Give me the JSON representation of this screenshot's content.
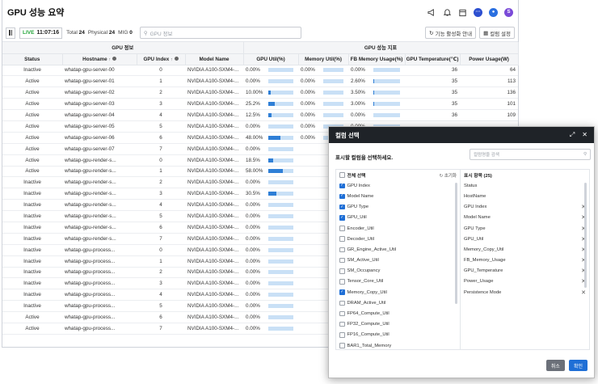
{
  "header": {
    "title": "GPU 성능 요약"
  },
  "toolbar": {
    "live": "LIVE",
    "time": "11:07:16",
    "total_label": "Total",
    "total": "24",
    "physical_label": "Physical",
    "physical": "24",
    "mig_label": "MIG",
    "mig": "0",
    "search_placeholder": "GPU 정보",
    "guide_label": "기능 활성화 안내",
    "column_label": "컬럼 설정"
  },
  "table": {
    "group_gpu_info": "GPU 정보",
    "group_gpu_perf": "GPU 성능 지표",
    "columns": [
      "Status",
      "Hostname",
      "GPU Index",
      "Model Name",
      "GPU Util(%)",
      "Memory Util(%)",
      "FB Memory Usage(%)",
      "GPU Temperature(℃)",
      "Power Usage(W)"
    ],
    "rows": [
      {
        "status": "Inactive",
        "host": "whatap-gpu-server-00",
        "idx": "0",
        "model": "NVIDIA A100-SXM4-...",
        "gpu": "0.00%",
        "gpu_v": 0,
        "mem": "0.00%",
        "mem_v": 0,
        "fb": "0.00%",
        "fb_v": 0,
        "temp": "36",
        "power": "64"
      },
      {
        "status": "Active",
        "host": "whatap-gpu-server-01",
        "idx": "1",
        "model": "NVIDIA A100-SXM4-...",
        "gpu": "0.00%",
        "gpu_v": 0,
        "mem": "0.00%",
        "mem_v": 0,
        "fb": "2.60%",
        "fb_v": 2.6,
        "temp": "35",
        "power": "113"
      },
      {
        "status": "Active",
        "host": "whatap-gpu-server-02",
        "idx": "2",
        "model": "NVIDIA A100-SXM4-...",
        "gpu": "10.00%",
        "gpu_v": 10,
        "mem": "0.00%",
        "mem_v": 0,
        "fb": "3.50%",
        "fb_v": 3.5,
        "temp": "35",
        "power": "136"
      },
      {
        "status": "Active",
        "host": "whatap-gpu-server-03",
        "idx": "3",
        "model": "NVIDIA A100-SXM4-...",
        "gpu": "25.2%",
        "gpu_v": 25.2,
        "mem": "0.00%",
        "mem_v": 0,
        "fb": "3.00%",
        "fb_v": 3,
        "temp": "35",
        "power": "101"
      },
      {
        "status": "Active",
        "host": "whatap-gpu-server-04",
        "idx": "4",
        "model": "NVIDIA A100-SXM4-...",
        "gpu": "12.5%",
        "gpu_v": 12.5,
        "mem": "0.00%",
        "mem_v": 0,
        "fb": "0.00%",
        "fb_v": 0,
        "temp": "36",
        "power": "109"
      },
      {
        "status": "Active",
        "host": "whatap-gpu-server-05",
        "idx": "5",
        "model": "NVIDIA A100-SXM4-...",
        "gpu": "0.00%",
        "gpu_v": 0,
        "mem": "0.00%",
        "mem_v": 0,
        "fb": "0.00%",
        "fb_v": 0,
        "temp": "",
        "power": ""
      },
      {
        "status": "Active",
        "host": "whatap-gpu-server-06",
        "idx": "6",
        "model": "NVIDIA A100-SXM4-...",
        "gpu": "48.00%",
        "gpu_v": 48,
        "mem": "0.00%",
        "mem_v": 0,
        "fb": "",
        "fb_v": 0,
        "temp": "",
        "power": ""
      },
      {
        "status": "Active",
        "host": "whatap-gpu-server-07",
        "idx": "7",
        "model": "NVIDIA A100-SXM4-...",
        "gpu": "0.00%",
        "gpu_v": 0,
        "mem": "",
        "mem_v": 0,
        "fb": "",
        "fb_v": 0,
        "temp": "",
        "power": ""
      },
      {
        "status": "Active",
        "host": "whatap-gpu-render-s...",
        "idx": "0",
        "model": "NVIDIA A100-SXM4-...",
        "gpu": "18.5%",
        "gpu_v": 18.5,
        "mem": "",
        "mem_v": 0,
        "fb": "",
        "fb_v": 0,
        "temp": "",
        "power": ""
      },
      {
        "status": "Active",
        "host": "whatap-gpu-render-s...",
        "idx": "1",
        "model": "NVIDIA A100-SXM4-...",
        "gpu": "58.00%",
        "gpu_v": 58,
        "mem": "",
        "mem_v": 0,
        "fb": "",
        "fb_v": 0,
        "temp": "",
        "power": ""
      },
      {
        "status": "Inactive",
        "host": "whatap-gpu-render-s...",
        "idx": "2",
        "model": "NVIDIA A100-SXM4-...",
        "gpu": "0.00%",
        "gpu_v": 0,
        "mem": "",
        "mem_v": 0,
        "fb": "",
        "fb_v": 0,
        "temp": "",
        "power": ""
      },
      {
        "status": "Inactive",
        "host": "whatap-gpu-render-s...",
        "idx": "3",
        "model": "NVIDIA A100-SXM4-...",
        "gpu": "30.5%",
        "gpu_v": 30.5,
        "mem": "",
        "mem_v": 0,
        "fb": "",
        "fb_v": 0,
        "temp": "",
        "power": ""
      },
      {
        "status": "Inactive",
        "host": "whatap-gpu-render-s...",
        "idx": "4",
        "model": "NVIDIA A100-SXM4-...",
        "gpu": "0.00%",
        "gpu_v": 0,
        "mem": "",
        "mem_v": 0,
        "fb": "",
        "fb_v": 0,
        "temp": "",
        "power": ""
      },
      {
        "status": "Inactive",
        "host": "whatap-gpu-render-s...",
        "idx": "5",
        "model": "NVIDIA A100-SXM4-...",
        "gpu": "0.00%",
        "gpu_v": 0,
        "mem": "",
        "mem_v": 0,
        "fb": "",
        "fb_v": 0,
        "temp": "",
        "power": ""
      },
      {
        "status": "Inactive",
        "host": "whatap-gpu-render-s...",
        "idx": "6",
        "model": "NVIDIA A100-SXM4-...",
        "gpu": "0.00%",
        "gpu_v": 0,
        "mem": "",
        "mem_v": 0,
        "fb": "",
        "fb_v": 0,
        "temp": "",
        "power": ""
      },
      {
        "status": "Inactive",
        "host": "whatap-gpu-render-s...",
        "idx": "7",
        "model": "NVIDIA A100-SXM4-...",
        "gpu": "0.00%",
        "gpu_v": 0,
        "mem": "",
        "mem_v": 0,
        "fb": "",
        "fb_v": 0,
        "temp": "",
        "power": ""
      },
      {
        "status": "Inactive",
        "host": "whatap-gpu-process...",
        "idx": "0",
        "model": "NVIDIA A100-SXM4-...",
        "gpu": "0.00%",
        "gpu_v": 0,
        "mem": "",
        "mem_v": 0,
        "fb": "",
        "fb_v": 0,
        "temp": "",
        "power": ""
      },
      {
        "status": "Inactive",
        "host": "whatap-gpu-process...",
        "idx": "1",
        "model": "NVIDIA A100-SXM4-...",
        "gpu": "0.00%",
        "gpu_v": 0,
        "mem": "",
        "mem_v": 0,
        "fb": "",
        "fb_v": 0,
        "temp": "",
        "power": ""
      },
      {
        "status": "Inactive",
        "host": "whatap-gpu-process...",
        "idx": "2",
        "model": "NVIDIA A100-SXM4-...",
        "gpu": "0.00%",
        "gpu_v": 0,
        "mem": "",
        "mem_v": 0,
        "fb": "",
        "fb_v": 0,
        "temp": "",
        "power": ""
      },
      {
        "status": "Inactive",
        "host": "whatap-gpu-process...",
        "idx": "3",
        "model": "NVIDIA A100-SXM4-...",
        "gpu": "0.00%",
        "gpu_v": 0,
        "mem": "",
        "mem_v": 0,
        "fb": "",
        "fb_v": 0,
        "temp": "",
        "power": ""
      },
      {
        "status": "Inactive",
        "host": "whatap-gpu-process...",
        "idx": "4",
        "model": "NVIDIA A100-SXM4-...",
        "gpu": "0.00%",
        "gpu_v": 0,
        "mem": "",
        "mem_v": 0,
        "fb": "",
        "fb_v": 0,
        "temp": "",
        "power": ""
      },
      {
        "status": "Inactive",
        "host": "whatap-gpu-process...",
        "idx": "5",
        "model": "NVIDIA A100-SXM4-...",
        "gpu": "0.00%",
        "gpu_v": 0,
        "mem": "",
        "mem_v": 0,
        "fb": "",
        "fb_v": 0,
        "temp": "",
        "power": ""
      },
      {
        "status": "Active",
        "host": "whatap-gpu-process...",
        "idx": "6",
        "model": "NVIDIA A100-SXM4-...",
        "gpu": "0.00%",
        "gpu_v": 0,
        "mem": "",
        "mem_v": 0,
        "fb": "",
        "fb_v": 0,
        "temp": "",
        "power": ""
      },
      {
        "status": "Active",
        "host": "whatap-gpu-process...",
        "idx": "7",
        "model": "NVIDIA A100-SXM4-...",
        "gpu": "0.00%",
        "gpu_v": 0,
        "mem": "",
        "mem_v": 0,
        "fb": "",
        "fb_v": 0,
        "temp": "",
        "power": ""
      }
    ]
  },
  "modal": {
    "title": "컬럼 선택",
    "description": "표시할 컬럼을 선택하세요.",
    "search_placeholder": "컬럼명을 검색",
    "select_all": "전체 선택",
    "reset": "초기화",
    "left_items": [
      {
        "label": "GPU Index",
        "checked": true
      },
      {
        "label": "Model Name",
        "checked": true
      },
      {
        "label": "GPU Type",
        "checked": true
      },
      {
        "label": "GPU_Util",
        "checked": true
      },
      {
        "label": "Encoder_Util",
        "checked": false
      },
      {
        "label": "Decoder_Util",
        "checked": false
      },
      {
        "label": "GR_Engine_Active_Util",
        "checked": false
      },
      {
        "label": "SM_Active_Util",
        "checked": false
      },
      {
        "label": "SM_Occupancy",
        "checked": false
      },
      {
        "label": "Tensor_Core_Util",
        "checked": false
      },
      {
        "label": "Memory_Copy_Util",
        "checked": true
      },
      {
        "label": "DRAM_Active_Util",
        "checked": false
      },
      {
        "label": "FP64_Compute_Util",
        "checked": false
      },
      {
        "label": "FP32_Compute_Util",
        "checked": false
      },
      {
        "label": "FP16_Compute_Util",
        "checked": false
      },
      {
        "label": "BAR1_Total_Memory",
        "checked": false
      }
    ],
    "right_header": "표시 항목 (25)",
    "right_items": [
      {
        "label": "Status",
        "removable": false
      },
      {
        "label": "HostName",
        "removable": false
      },
      {
        "label": "GPU Index",
        "removable": true
      },
      {
        "label": "Model Name",
        "removable": true
      },
      {
        "label": "GPU Type",
        "removable": true
      },
      {
        "label": "GPU_Util",
        "removable": true
      },
      {
        "label": "Memory_Copy_Util",
        "removable": true
      },
      {
        "label": "FB_Memory_Usage",
        "removable": true
      },
      {
        "label": "GPU_Temperature",
        "removable": true
      },
      {
        "label": "Power_Usage",
        "removable": true
      },
      {
        "label": "Persistence Mode",
        "removable": true
      }
    ],
    "cancel": "취소",
    "confirm": "확인"
  },
  "colors": {
    "accent": "#1f6fd6",
    "live": "#23a43a",
    "bar_fill": "#2f7fd6",
    "bar_track": "#c9e0f6",
    "modal_header": "#1f2328"
  }
}
